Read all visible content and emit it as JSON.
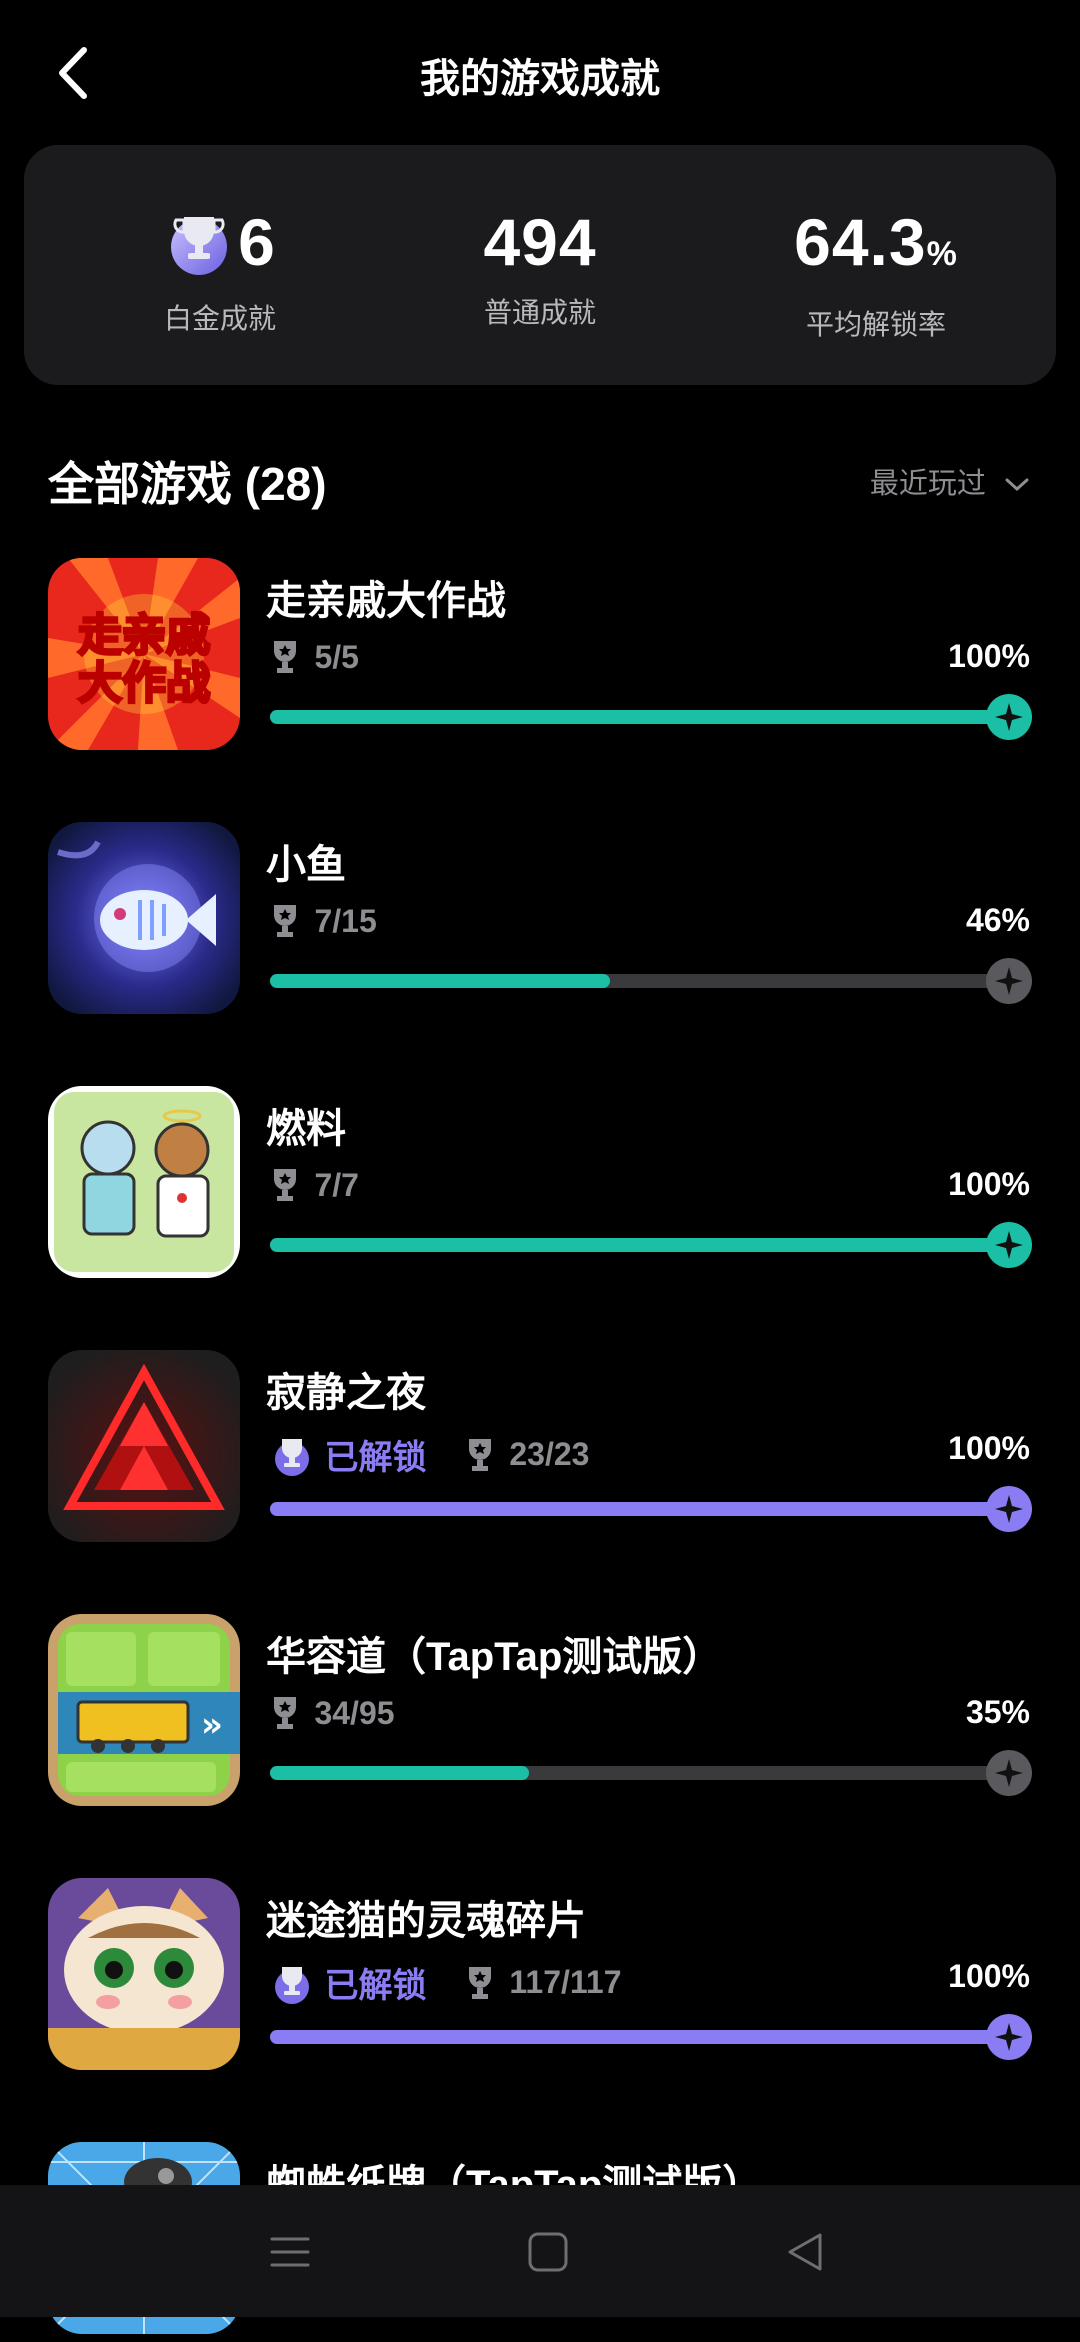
{
  "header": {
    "title": "我的游戏成就",
    "back_icon": "back-arrow-icon"
  },
  "summary": {
    "platinum": {
      "value": "6",
      "label": "白金成就"
    },
    "normal": {
      "value": "494",
      "label": "普通成就"
    },
    "rate": {
      "value": "64.3",
      "unit": "%",
      "label": "平均解锁率"
    }
  },
  "section": {
    "title": "全部游戏 (28)",
    "sort_label": "最近玩过"
  },
  "colors": {
    "accent_teal": "#1bbfa5",
    "accent_purple": "#8a7cf2",
    "track": "#3a3a3d"
  },
  "games": [
    {
      "name": "走亲戚大作战",
      "unlocked_label": "",
      "count": "5/5",
      "percent": "100%",
      "progress": 1.0,
      "color": "#1bbfa5"
    },
    {
      "name": "小鱼",
      "unlocked_label": "",
      "count": "7/15",
      "percent": "46%",
      "progress": 0.46,
      "color": "#1bbfa5"
    },
    {
      "name": "燃料",
      "unlocked_label": "",
      "count": "7/7",
      "percent": "100%",
      "progress": 1.0,
      "color": "#1bbfa5"
    },
    {
      "name": "寂静之夜",
      "unlocked_label": "已解锁",
      "count": "23/23",
      "percent": "100%",
      "progress": 1.0,
      "color": "#8a7cf2"
    },
    {
      "name": "华容道（TapTap测试版）",
      "unlocked_label": "",
      "count": "34/95",
      "percent": "35%",
      "progress": 0.35,
      "color": "#1bbfa5"
    },
    {
      "name": "迷途猫的灵魂碎片",
      "unlocked_label": "已解锁",
      "count": "117/117",
      "percent": "100%",
      "progress": 1.0,
      "color": "#8a7cf2"
    },
    {
      "name": "蜘蛛纸牌（TapTap测试版）"
    }
  ],
  "nav": {
    "menu_icon": "menu-icon",
    "home_icon": "home-square-icon",
    "back_icon": "back-triangle-icon"
  }
}
